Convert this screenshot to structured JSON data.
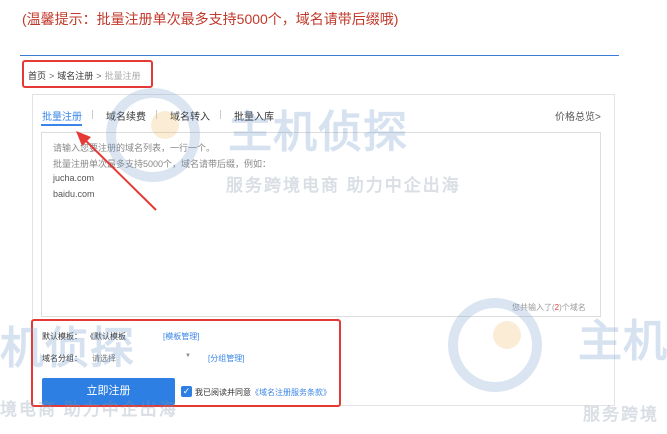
{
  "tip": "(温馨提示：批量注册单次最多支持5000个，域名请带后缀哦)",
  "breadcrumb": {
    "home": "首页",
    "sep": ">",
    "domain_register": "域名注册",
    "current": "批量注册"
  },
  "tabs": [
    {
      "label": "批量注册",
      "active": true
    },
    {
      "label": "域名续费",
      "active": false
    },
    {
      "label": "域名转入",
      "active": false
    },
    {
      "label": "批量入库",
      "active": false
    }
  ],
  "price_overview": "价格总览>",
  "textarea": {
    "lines": [
      "请输入您要注册的域名列表，一行一个。",
      "批量注册单次最多支持5000个，域名请带后缀，例如：",
      "jucha.com",
      "baidu.com"
    ],
    "count_prefix": "您共输入了(",
    "count_value": "2",
    "count_suffix": ")个域名"
  },
  "form": {
    "template_label": "默认模板：",
    "template_value": "《默认模板",
    "template_manage": "[模板管理]",
    "group_label": "域名分组：",
    "group_placeholder": "请选择",
    "group_manage": "[分组管理]",
    "submit_label": "立即注册",
    "agree_text": "我已阅读并同意",
    "agree_link": "《域名注册服务条款》",
    "agree_checked": true
  },
  "watermarks": {
    "brand": "主机侦探",
    "slogan": "服务跨境电商 助力中企出海",
    "brand_fragment": "机侦探",
    "brand_fragment_right": "主机",
    "slogan_fragment": "境电商 助力中企出海",
    "slogan_fragment_right": "服务跨境"
  }
}
